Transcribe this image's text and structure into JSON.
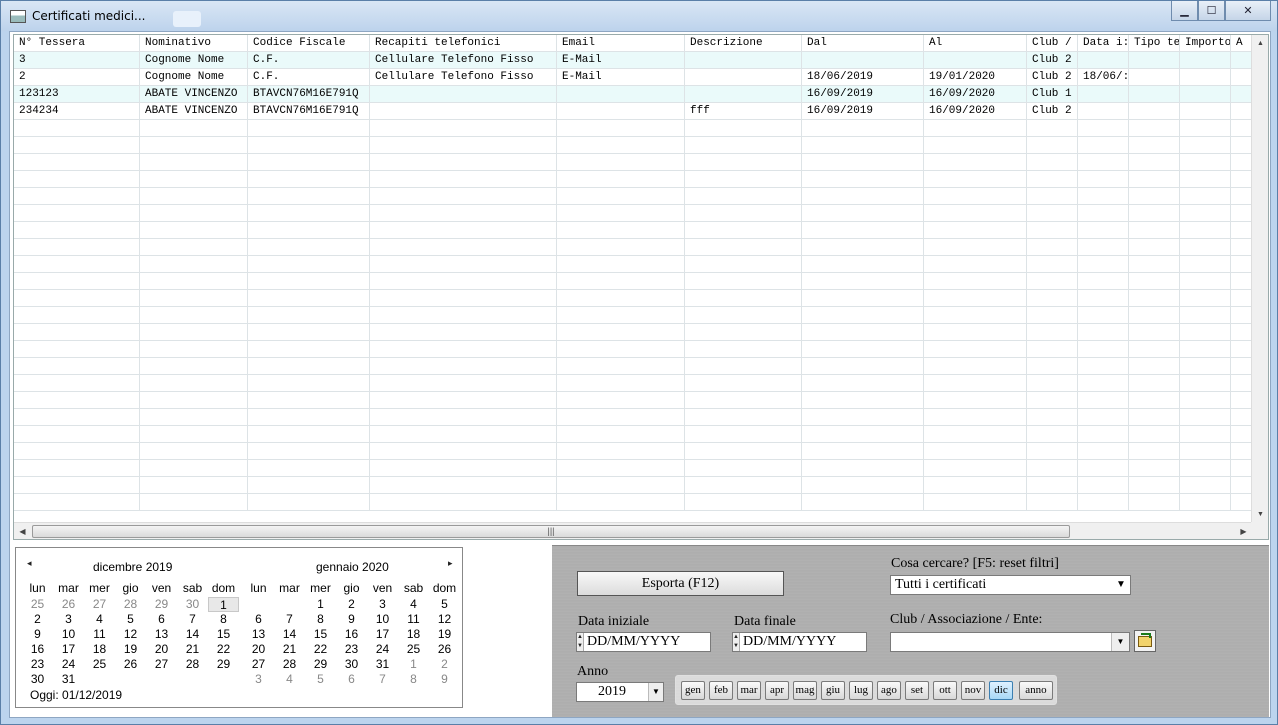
{
  "window": {
    "title": "Certificati medici..."
  },
  "grid": {
    "columns": [
      "N° Tessera",
      "Nominativo",
      "Codice Fiscale",
      "Recapiti telefonici",
      "Email",
      "Descrizione",
      "Dal",
      "Al",
      "Club /",
      "Data i:",
      "Tipo te",
      "Importo",
      "A"
    ],
    "rows": [
      [
        "3",
        "Cognome Nome",
        "C.F.",
        "Cellulare Telefono Fisso",
        "E-Mail",
        "",
        "",
        "",
        "Club 2",
        "",
        "",
        "",
        ""
      ],
      [
        "2",
        "Cognome Nome",
        "C.F.",
        "Cellulare Telefono Fisso",
        "E-Mail",
        "",
        "18/06/2019",
        "19/01/2020",
        "Club 2",
        "18/06/:",
        "",
        "",
        ""
      ],
      [
        "123123",
        "ABATE VINCENZO",
        "BTAVCN76M16E791Q",
        "",
        "",
        "",
        "16/09/2019",
        "16/09/2020",
        "Club 1",
        "",
        "",
        "",
        ""
      ],
      [
        "234234",
        "ABATE VINCENZO",
        "BTAVCN76M16E791Q",
        "",
        "",
        "fff",
        "16/09/2019",
        "16/09/2020",
        "Club 2",
        "",
        "",
        "",
        ""
      ]
    ],
    "hscroll_grip": "|||"
  },
  "calendar": {
    "prev_icon": "◂",
    "next_icon": "▸",
    "month1": "dicembre 2019",
    "month2": "gennaio 2020",
    "weekdays": [
      "lun",
      "mar",
      "mer",
      "gio",
      "ven",
      "sab",
      "dom"
    ],
    "weeks1": [
      [
        [
          "25",
          1
        ],
        [
          "26",
          1
        ],
        [
          "27",
          1
        ],
        [
          "28",
          1
        ],
        [
          "29",
          1
        ],
        [
          "30",
          1
        ],
        [
          "1",
          0
        ]
      ],
      [
        [
          "2",
          0
        ],
        [
          "3",
          0
        ],
        [
          "4",
          0
        ],
        [
          "5",
          0
        ],
        [
          "6",
          0
        ],
        [
          "7",
          0
        ],
        [
          "8",
          0
        ]
      ],
      [
        [
          "9",
          0
        ],
        [
          "10",
          0
        ],
        [
          "11",
          0
        ],
        [
          "12",
          0
        ],
        [
          "13",
          0
        ],
        [
          "14",
          0
        ],
        [
          "15",
          0
        ]
      ],
      [
        [
          "16",
          0
        ],
        [
          "17",
          0
        ],
        [
          "18",
          0
        ],
        [
          "19",
          0
        ],
        [
          "20",
          0
        ],
        [
          "21",
          0
        ],
        [
          "22",
          0
        ]
      ],
      [
        [
          "23",
          0
        ],
        [
          "24",
          0
        ],
        [
          "25",
          0
        ],
        [
          "26",
          0
        ],
        [
          "27",
          0
        ],
        [
          "28",
          0
        ],
        [
          "29",
          0
        ]
      ],
      [
        [
          "30",
          0
        ],
        [
          "31",
          0
        ],
        [
          "",
          0
        ],
        [
          "",
          0
        ],
        [
          "",
          0
        ],
        [
          "",
          0
        ],
        [
          "",
          0
        ]
      ]
    ],
    "weeks2": [
      [
        [
          "",
          0
        ],
        [
          "",
          0
        ],
        [
          "1",
          0
        ],
        [
          "2",
          0
        ],
        [
          "3",
          0
        ],
        [
          "4",
          0
        ],
        [
          "5",
          0
        ]
      ],
      [
        [
          "6",
          0
        ],
        [
          "7",
          0
        ],
        [
          "8",
          0
        ],
        [
          "9",
          0
        ],
        [
          "10",
          0
        ],
        [
          "11",
          0
        ],
        [
          "12",
          0
        ]
      ],
      [
        [
          "13",
          0
        ],
        [
          "14",
          0
        ],
        [
          "15",
          0
        ],
        [
          "16",
          0
        ],
        [
          "17",
          0
        ],
        [
          "18",
          0
        ],
        [
          "19",
          0
        ]
      ],
      [
        [
          "20",
          0
        ],
        [
          "21",
          0
        ],
        [
          "22",
          0
        ],
        [
          "23",
          0
        ],
        [
          "24",
          0
        ],
        [
          "25",
          0
        ],
        [
          "26",
          0
        ]
      ],
      [
        [
          "27",
          0
        ],
        [
          "28",
          0
        ],
        [
          "29",
          0
        ],
        [
          "30",
          0
        ],
        [
          "31",
          0
        ],
        [
          "1",
          1
        ],
        [
          "2",
          1
        ]
      ],
      [
        [
          "3",
          1
        ],
        [
          "4",
          1
        ],
        [
          "5",
          1
        ],
        [
          "6",
          1
        ],
        [
          "7",
          1
        ],
        [
          "8",
          1
        ],
        [
          "9",
          1
        ]
      ]
    ],
    "today_label": "Oggi: 01/12/2019"
  },
  "panel": {
    "export_button": "Esporta (F12)",
    "search_label": "Cosa cercare? [F5: reset filtri]",
    "search_value": "Tutti i certificati",
    "start_label": "Data iniziale",
    "start_value": "DD/MM/YYYY",
    "end_label": "Data finale",
    "end_value": "DD/MM/YYYY",
    "club_label": "Club / Associazione / Ente:",
    "club_value": "",
    "year_label": "Anno",
    "year_value": "2019",
    "months": [
      "gen",
      "feb",
      "mar",
      "apr",
      "mag",
      "giu",
      "lug",
      "ago",
      "set",
      "ott",
      "nov",
      "dic"
    ],
    "selected_month": "dic",
    "anno_button": "anno"
  },
  "colors": {
    "row_alt": "#eafafa",
    "month_selected": "#a8d8f6"
  }
}
